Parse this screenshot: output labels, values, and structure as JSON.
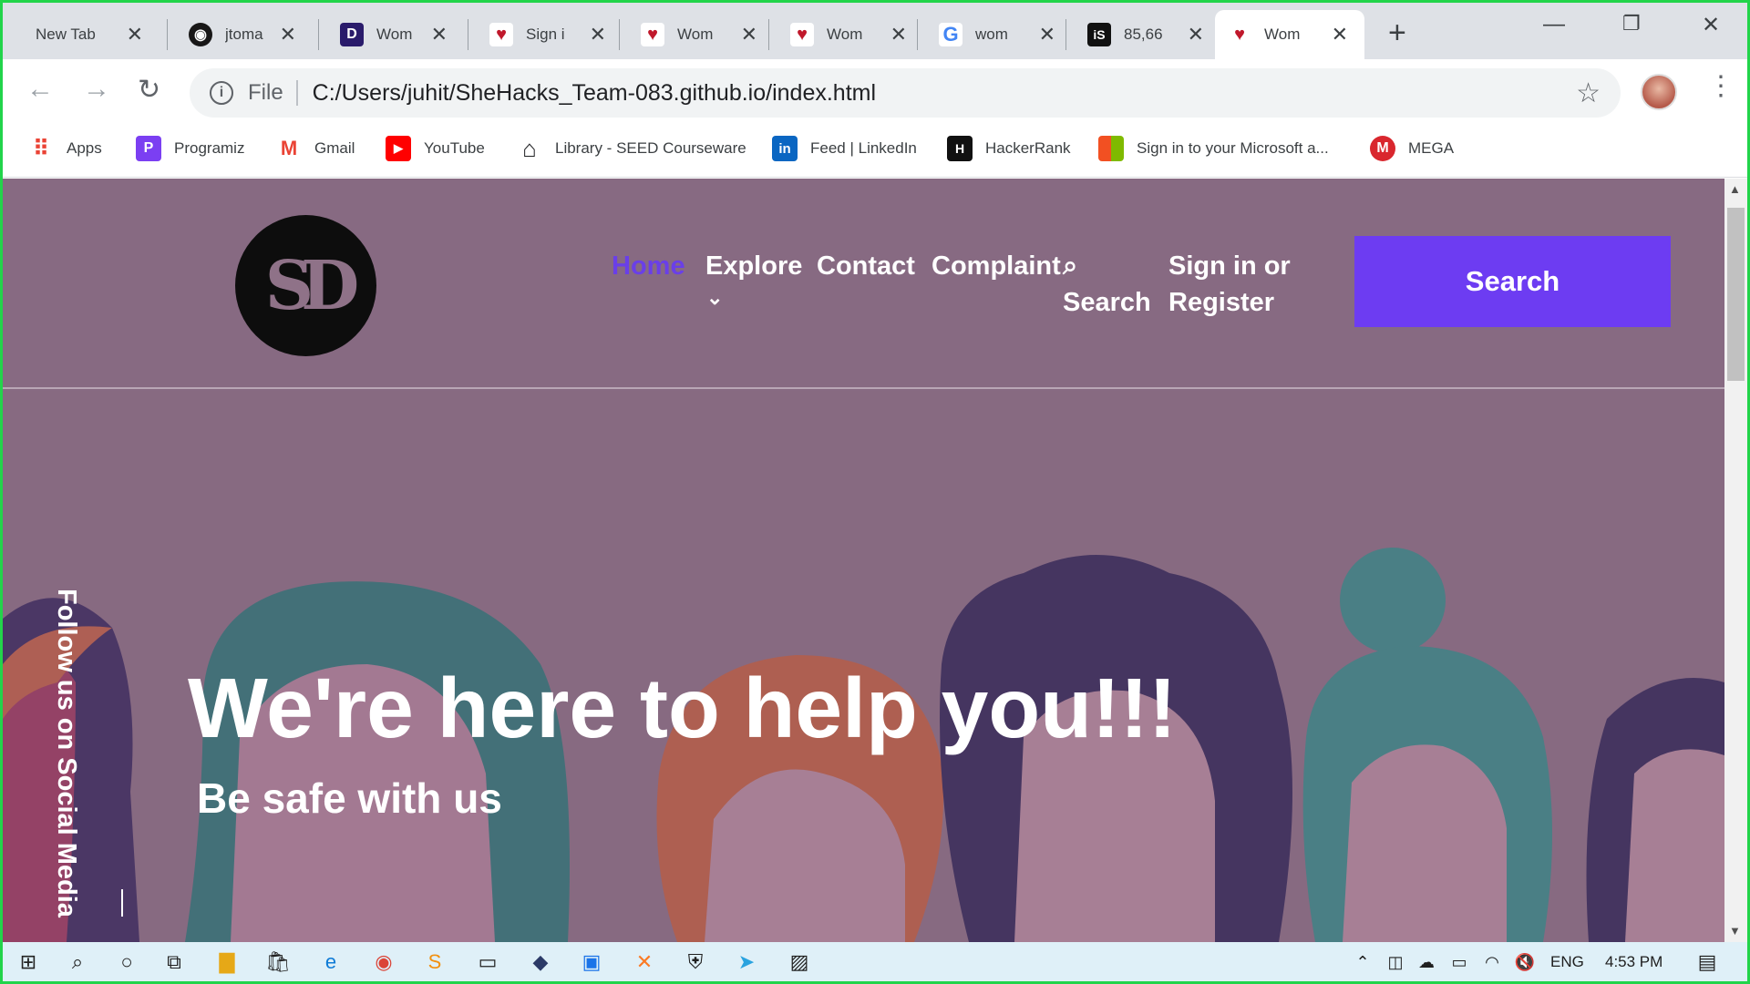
{
  "browser": {
    "tabs": [
      {
        "title": "New Tab",
        "favicon": "none"
      },
      {
        "title": "jtoma",
        "favicon": "github-icon"
      },
      {
        "title": "Wom",
        "favicon": "d-icon"
      },
      {
        "title": "Sign i",
        "favicon": "women-logo-icon"
      },
      {
        "title": "Wom",
        "favicon": "women-logo-icon"
      },
      {
        "title": "Wom",
        "favicon": "women-logo-icon"
      },
      {
        "title": "wom",
        "favicon": "google-icon"
      },
      {
        "title": "85,66",
        "favicon": "is-icon"
      },
      {
        "title": "Wom",
        "favicon": "women-logo-icon",
        "active": true
      }
    ],
    "address": {
      "scheme_label": "File",
      "url": "C:/Users/juhit/SheHacks_Team-083.github.io/index.html"
    },
    "bookmarks": [
      {
        "label": "Apps",
        "icon": "apps-grid-icon"
      },
      {
        "label": "Programiz",
        "icon": "programiz-icon"
      },
      {
        "label": "Gmail",
        "icon": "gmail-icon"
      },
      {
        "label": "YouTube",
        "icon": "youtube-icon"
      },
      {
        "label": "Library - SEED Courseware",
        "icon": "home-icon"
      },
      {
        "label": "Feed | LinkedIn",
        "icon": "linkedin-icon"
      },
      {
        "label": "HackerRank",
        "icon": "hackerrank-icon"
      },
      {
        "label": "Sign in to your Microsoft a...",
        "icon": "microsoft-icon"
      },
      {
        "label": "MEGA",
        "icon": "mega-icon"
      }
    ]
  },
  "site": {
    "logo_text": "SD",
    "nav": {
      "home": "Home",
      "explore": "Explore",
      "contact": "Contact",
      "complaint": "Complaint",
      "search": "Search",
      "signin_line1": "Sign in or",
      "signin_line2": "Register"
    },
    "cta_search": "Search",
    "hero": {
      "title": "We're here to help you!!!",
      "subtitle": "Be safe with us",
      "social": "Follow us on Social Media"
    },
    "colors": {
      "background": "#876a82",
      "accent": "#6d3cf2",
      "home_link": "#6a3fe8"
    }
  },
  "taskbar": {
    "language": "ENG",
    "time": "4:53 PM"
  }
}
